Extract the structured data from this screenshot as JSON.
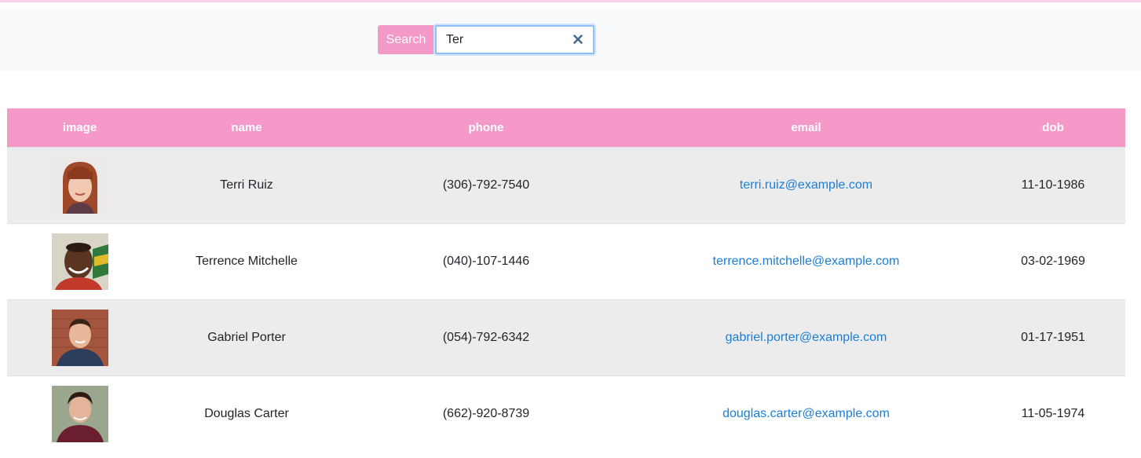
{
  "search": {
    "button_label": "Search",
    "value": "Ter",
    "clear_icon": "close-icon"
  },
  "colors": {
    "accent": "#f599c9",
    "link": "#1a7ed8",
    "row_stripe": "#ececec"
  },
  "table": {
    "headers": [
      "image",
      "name",
      "phone",
      "email",
      "dob"
    ],
    "rows": [
      {
        "image": "avatar-terri-ruiz",
        "name": "Terri Ruiz",
        "phone": "(306)-792-7540",
        "email": "terri.ruiz@example.com",
        "dob": "11-10-1986"
      },
      {
        "image": "avatar-terrence-mitchelle",
        "name": "Terrence Mitchelle",
        "phone": "(040)-107-1446",
        "email": "terrence.mitchelle@example.com",
        "dob": "03-02-1969"
      },
      {
        "image": "avatar-gabriel-porter",
        "name": "Gabriel Porter",
        "phone": "(054)-792-6342",
        "email": "gabriel.porter@example.com",
        "dob": "01-17-1951"
      },
      {
        "image": "avatar-douglas-carter",
        "name": "Douglas Carter",
        "phone": "(662)-920-8739",
        "email": "douglas.carter@example.com",
        "dob": "11-05-1974"
      }
    ]
  }
}
